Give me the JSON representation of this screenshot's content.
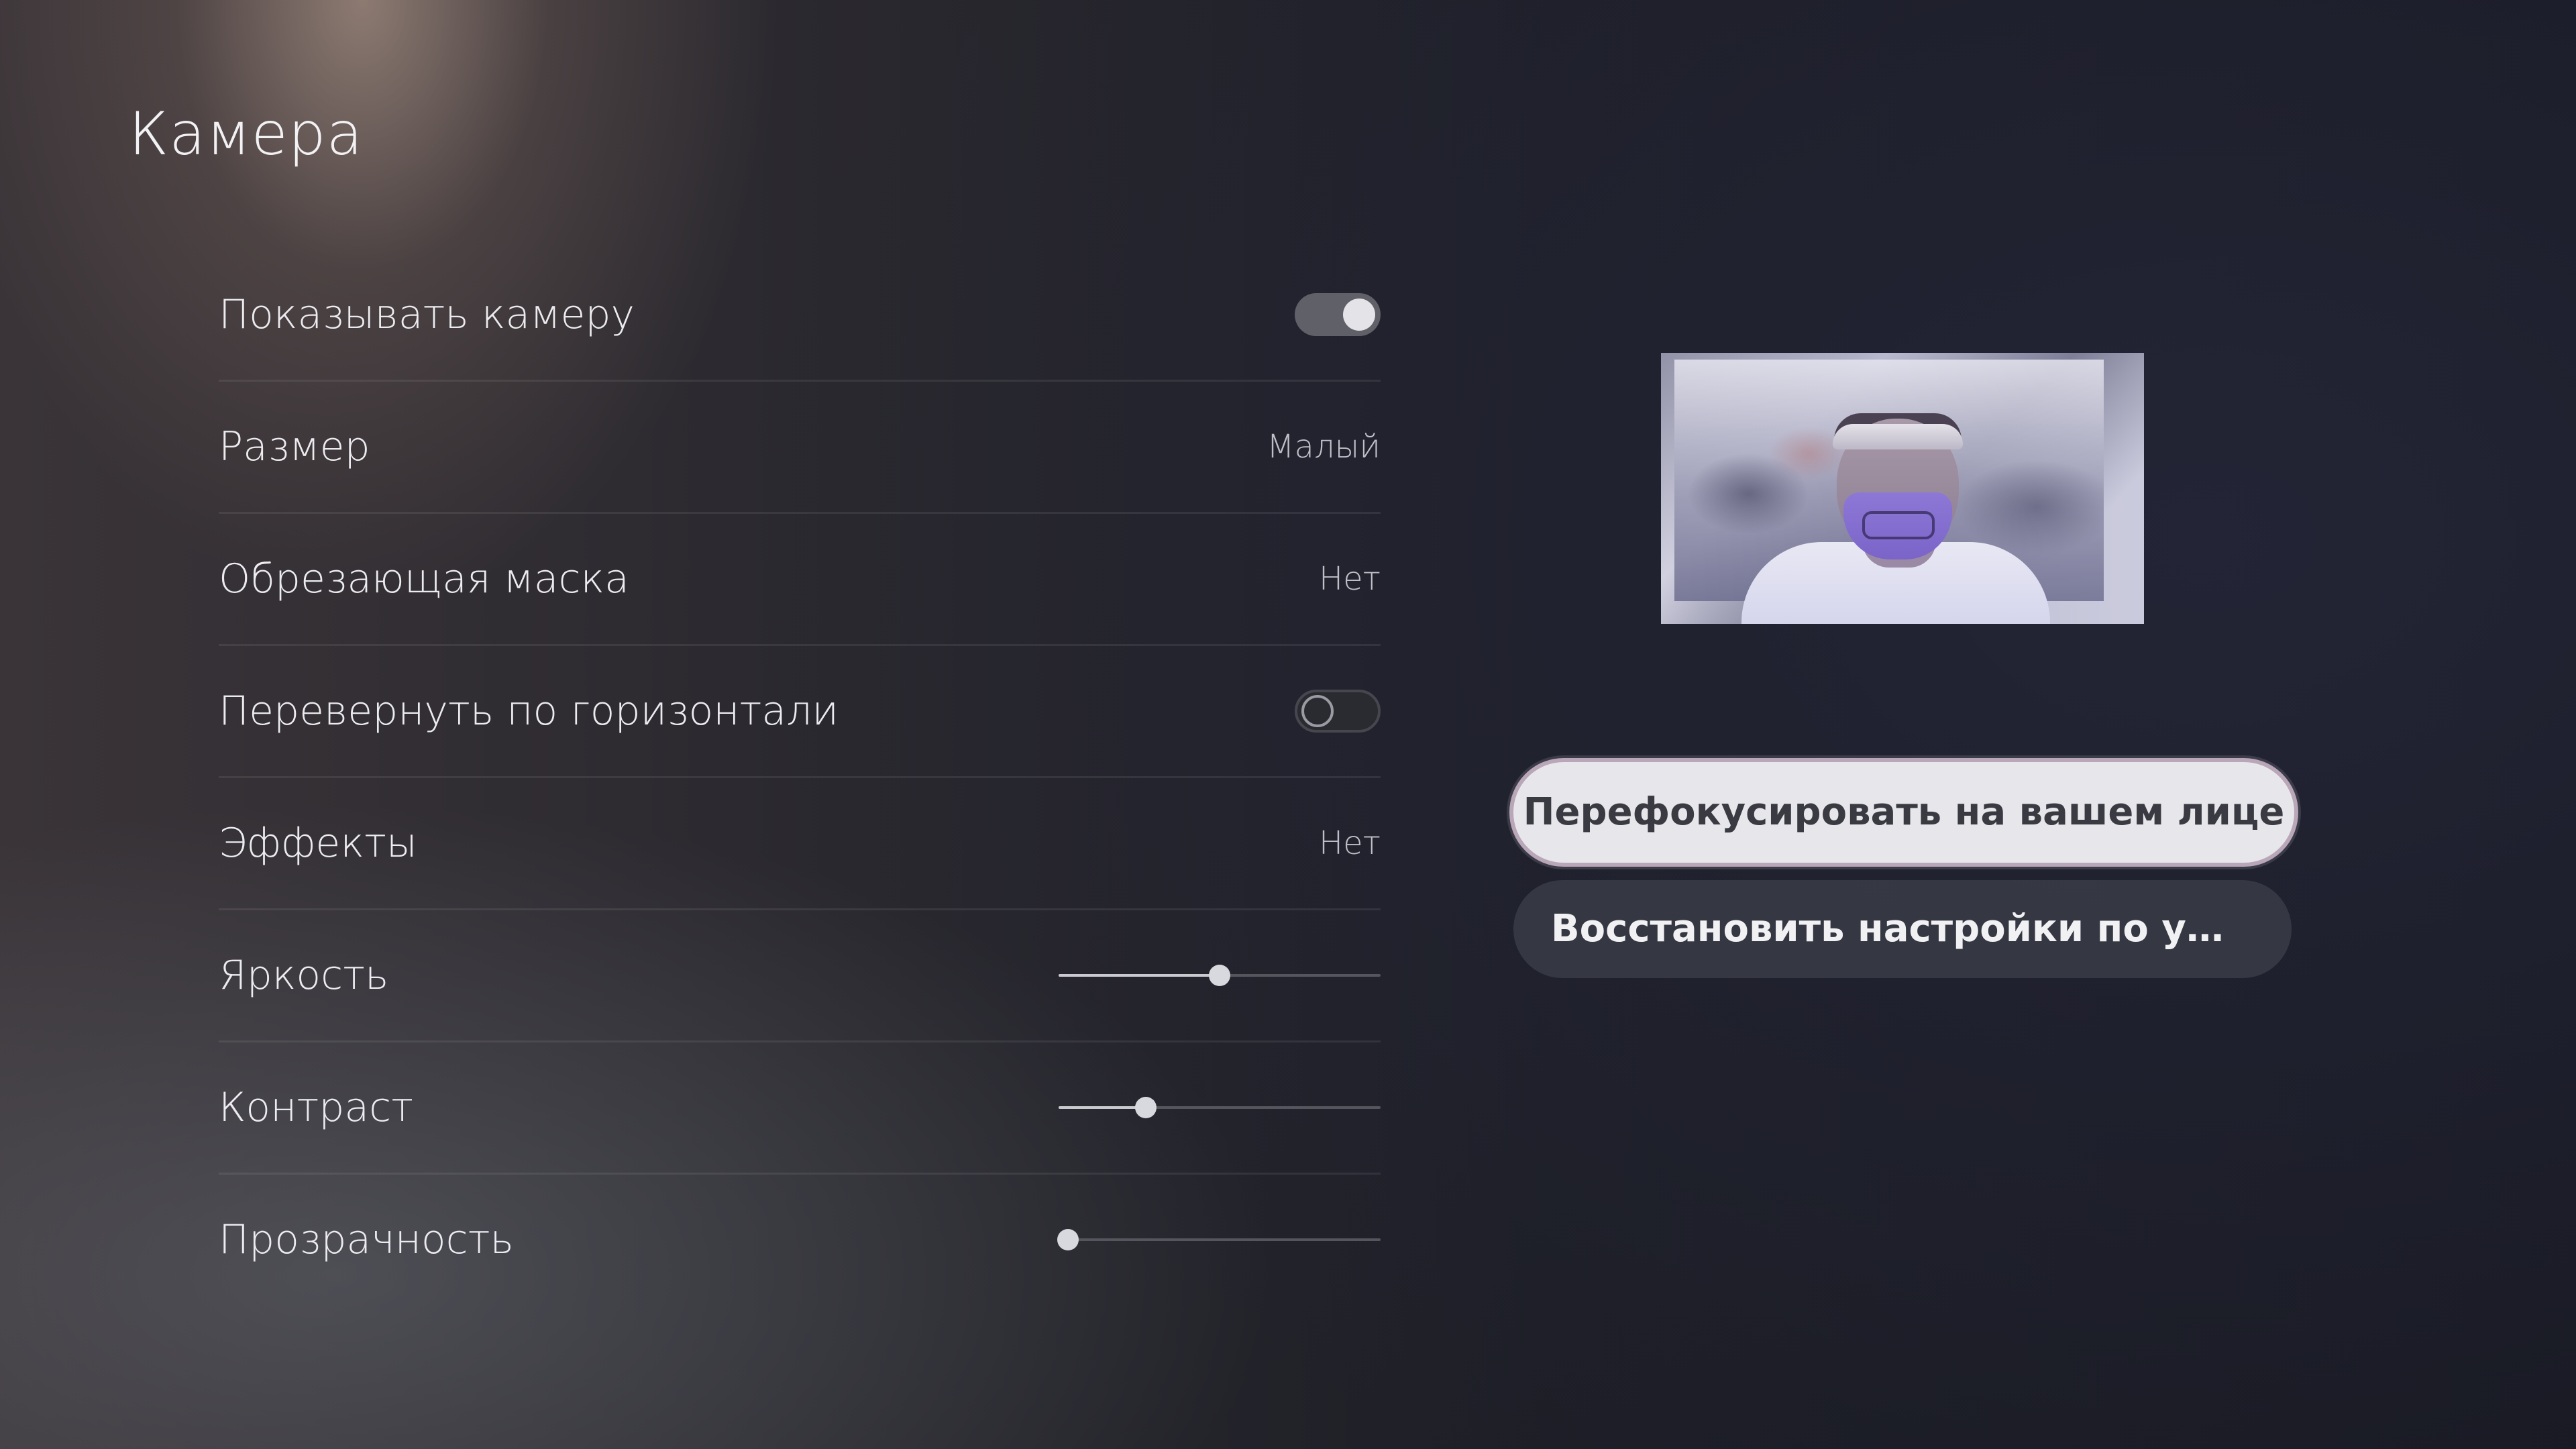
{
  "page": {
    "title": "Камера"
  },
  "settings": [
    {
      "key": "show_camera",
      "label": "Показывать камеру",
      "control": "toggle",
      "state": "on"
    },
    {
      "key": "size",
      "label": "Размер",
      "control": "value",
      "value": "Малый"
    },
    {
      "key": "crop_mask",
      "label": "Обрезающая маска",
      "control": "value",
      "value": "Нет"
    },
    {
      "key": "flip_horizontal",
      "label": "Перевернуть по горизонтали",
      "control": "toggle",
      "state": "off"
    },
    {
      "key": "effects",
      "label": "Эффекты",
      "control": "value",
      "value": "Нет"
    },
    {
      "key": "brightness",
      "label": "Яркость",
      "control": "slider",
      "level": 0.5
    },
    {
      "key": "contrast",
      "label": "Контраст",
      "control": "slider",
      "level": 0.27
    },
    {
      "key": "transparency",
      "label": "Прозрачность",
      "control": "slider",
      "level": 0.03
    }
  ],
  "preview": {
    "icon": "camera-preview-image"
  },
  "actions": {
    "refocus_label": "Перефокусировать на вашем лице",
    "restore_label": "Восстановить настройки по умол..."
  },
  "colors": {
    "button_focused_bg": "#e7e7eb",
    "button_bg": "#3a3c46",
    "toggle_on": "#5f6068",
    "slider_fill": "#c9cad0"
  }
}
